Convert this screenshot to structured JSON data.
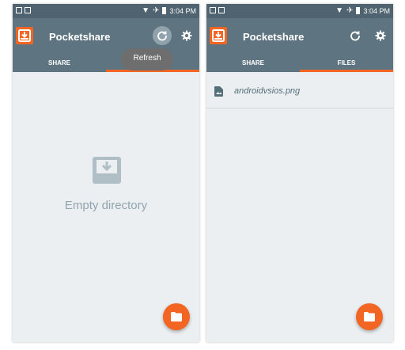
{
  "status_bar": {
    "time": "3:04 PM"
  },
  "app": {
    "title": "Pocketshare"
  },
  "tabs": {
    "share": "SHARE",
    "files": "FILES"
  },
  "left_screen": {
    "tooltip": "Refresh",
    "empty_state": "Empty directory"
  },
  "right_screen": {
    "files": [
      {
        "name": "androidvsios.png"
      }
    ]
  },
  "icons": {
    "logo": "download-tray-icon",
    "refresh": "refresh-icon",
    "settings": "gear-icon",
    "fab": "folder-icon",
    "file": "image-file-icon"
  },
  "colors": {
    "appbar": "#5e7581",
    "statusbar": "#4f6470",
    "accent": "#f26522",
    "background": "#eceff1"
  }
}
